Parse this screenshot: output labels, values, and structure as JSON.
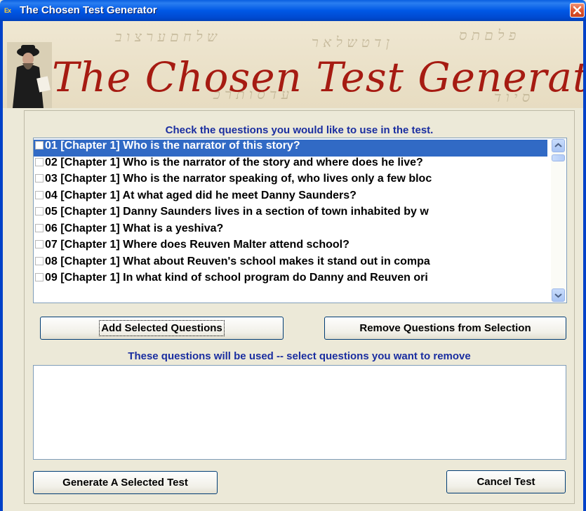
{
  "window": {
    "title": "The Chosen Test Generator",
    "icon": "app-icon",
    "icon_text": "Ex"
  },
  "banner": {
    "title": "The Chosen Test Generator"
  },
  "questions_list": {
    "instruction": "Check the questions you would like to use in the test.",
    "items": [
      {
        "label": "01 [Chapter 1] Who is the narrator of this story?",
        "selected": true,
        "checked": false
      },
      {
        "label": "02 [Chapter 1] Who is the narrator of the story and where does he live?",
        "selected": false,
        "checked": false
      },
      {
        "label": "03 [Chapter 1] Who is the narrator speaking of, who lives only a few bloc",
        "selected": false,
        "checked": false
      },
      {
        "label": "04 [Chapter 1] At what aged did he meet Danny Saunders?",
        "selected": false,
        "checked": false
      },
      {
        "label": "05 [Chapter 1] Danny Saunders lives in a section of town inhabited by w",
        "selected": false,
        "checked": false
      },
      {
        "label": "06 [Chapter 1] What is a yeshiva?",
        "selected": false,
        "checked": false
      },
      {
        "label": "07 [Chapter 1] Where does Reuven Malter attend school?",
        "selected": false,
        "checked": false
      },
      {
        "label": "08 [Chapter 1] What about Reuven's school makes it stand out in compa",
        "selected": false,
        "checked": false
      },
      {
        "label": "09 [Chapter 1] In what kind of school program do Danny and Reuven ori",
        "selected": false,
        "checked": false
      }
    ]
  },
  "buttons": {
    "add": "Add Selected Questions",
    "remove": "Remove Questions from Selection",
    "generate": "Generate A Selected Test",
    "cancel": "Cancel Test"
  },
  "selected_list": {
    "instruction": "These questions will be used --  select questions you want to remove",
    "items": []
  },
  "colors": {
    "title_bar": "#0058e6",
    "banner_title": "#a61b12",
    "label_text": "#1a2ea0",
    "selection": "#316ac5",
    "window_bg": "#ece9d8"
  }
}
